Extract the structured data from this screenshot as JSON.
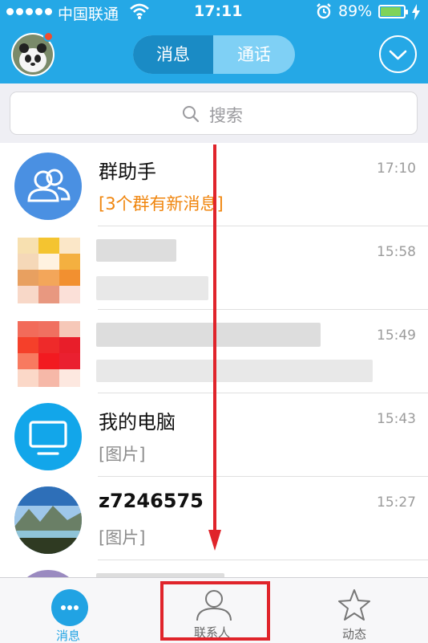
{
  "status_bar": {
    "carrier": "中国联通",
    "time": "17:11",
    "battery": "89%"
  },
  "header": {
    "tab_messages": "消息",
    "tab_calls": "通话"
  },
  "search": {
    "placeholder": "搜索"
  },
  "conversations": [
    {
      "name": "群助手",
      "preview": "[3个群有新消息]",
      "time": "17:10"
    },
    {
      "name": "",
      "preview": "",
      "time": "15:58"
    },
    {
      "name": "",
      "preview": "",
      "time": "15:49"
    },
    {
      "name": "我的电脑",
      "preview": "[图片]",
      "time": "15:43"
    },
    {
      "name": "z7246575",
      "preview": "[图片]",
      "time": "15:27"
    }
  ],
  "tabbar": {
    "messages": "消息",
    "contacts": "联系人",
    "moments": "动态"
  },
  "colors": {
    "header_blue": "#25a8e6",
    "segment_active": "#1a8bc5",
    "preview_orange": "#f0860f",
    "annotation_red": "#e0242b"
  }
}
